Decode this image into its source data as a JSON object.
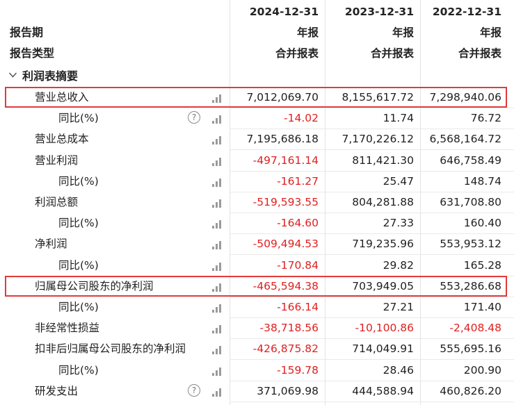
{
  "header": {
    "dates": [
      "2024-12-31",
      "2023-12-31",
      "2022-12-31"
    ],
    "report_period_label": "报告期",
    "report_periods": [
      "年报",
      "年报",
      "年报"
    ],
    "report_type_label": "报告类型",
    "report_types": [
      "合并报表",
      "合并报表",
      "合并报表"
    ]
  },
  "section": {
    "title": "利润表摘要"
  },
  "rows": [
    {
      "label": "营业总收入",
      "values": [
        "7,012,069.70",
        "8,155,617.72",
        "7,298,940.06"
      ]
    },
    {
      "label": "同比(%)",
      "values": [
        "-14.02",
        "11.74",
        "76.72"
      ]
    },
    {
      "label": "营业总成本",
      "values": [
        "7,195,686.18",
        "7,170,226.12",
        "6,568,164.72"
      ]
    },
    {
      "label": "营业利润",
      "values": [
        "-497,161.14",
        "811,421.30",
        "646,758.49"
      ]
    },
    {
      "label": "同比(%)",
      "values": [
        "-161.27",
        "25.47",
        "148.74"
      ]
    },
    {
      "label": "利润总额",
      "values": [
        "-519,593.55",
        "804,281.88",
        "631,708.80"
      ]
    },
    {
      "label": "同比(%)",
      "values": [
        "-164.60",
        "27.33",
        "160.40"
      ]
    },
    {
      "label": "净利润",
      "values": [
        "-509,494.53",
        "719,235.96",
        "553,953.12"
      ]
    },
    {
      "label": "同比(%)",
      "values": [
        "-170.84",
        "29.82",
        "165.28"
      ]
    },
    {
      "label": "归属母公司股东的净利润",
      "values": [
        "-465,594.38",
        "703,949.05",
        "553,286.68"
      ]
    },
    {
      "label": "同比(%)",
      "values": [
        "-166.14",
        "27.21",
        "171.40"
      ]
    },
    {
      "label": "非经常性损益",
      "values": [
        "-38,718.56",
        "-10,100.86",
        "-2,408.48"
      ]
    },
    {
      "label": "扣非后归属母公司股东的净利润",
      "values": [
        "-426,875.82",
        "714,049.91",
        "555,695.16"
      ]
    },
    {
      "label": "同比(%)",
      "values": [
        "-159.78",
        "28.46",
        "200.90"
      ]
    },
    {
      "label": "研发支出",
      "values": [
        "371,069.98",
        "444,588.94",
        "460,826.20"
      ]
    }
  ],
  "colors": {
    "negative": "#e02020",
    "highlight_border": "#e03a3a"
  },
  "icons": {
    "chart": "bar-chart-icon",
    "help": "help-icon",
    "collapse": "chevron-down-icon",
    "help_glyph": "?"
  }
}
